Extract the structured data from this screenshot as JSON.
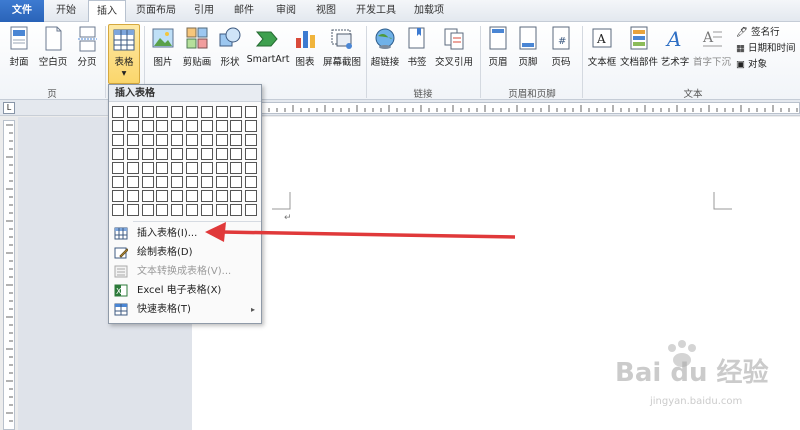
{
  "tabs": [
    {
      "label": "文件"
    },
    {
      "label": "开始"
    },
    {
      "label": "插入"
    },
    {
      "label": "页面布局"
    },
    {
      "label": "引用"
    },
    {
      "label": "邮件"
    },
    {
      "label": "审阅"
    },
    {
      "label": "视图"
    },
    {
      "label": "开发工具"
    },
    {
      "label": "加载项"
    }
  ],
  "ribbon": {
    "pages": {
      "cover": "封面",
      "blank": "空白页",
      "break": "分页",
      "group": "页"
    },
    "table": {
      "label": "表格",
      "dropdown_arrow": "▾"
    },
    "illustrations": {
      "picture": "图片",
      "clipart": "剪贴画",
      "shapes": "形状",
      "smartart": "SmartArt",
      "chart": "图表",
      "screenshot": "屏幕截图"
    },
    "links": {
      "hyperlink": "超链接",
      "bookmark": "书签",
      "crossref": "交叉引用",
      "group": "链接"
    },
    "header_footer": {
      "header": "页眉",
      "footer": "页脚",
      "page_number": "页码",
      "group": "页眉和页脚"
    },
    "text": {
      "textbox": "文本框",
      "quickparts": "文档部件",
      "wordart": "艺术字",
      "dropcap": "首字下沉",
      "signature": "签名行",
      "datetime": "日期和时间",
      "object": "对象",
      "group": "文本"
    }
  },
  "dropdown": {
    "title": "插入表格",
    "items": [
      {
        "label": "插入表格(I)..."
      },
      {
        "label": "绘制表格(D)"
      },
      {
        "label": "文本转换成表格(V)..."
      },
      {
        "label": "Excel 电子表格(X)"
      },
      {
        "label": "快速表格(T)"
      }
    ],
    "submenu_arrow": "▸"
  },
  "ruler": {
    "corner": "L"
  },
  "watermark": {
    "brand": "Bai du 经验",
    "url": "jingyan.baidu.com"
  },
  "colors": {
    "accent": "#2a63b8",
    "arrow": "#e0393a",
    "pressed": "#fbd66c"
  }
}
